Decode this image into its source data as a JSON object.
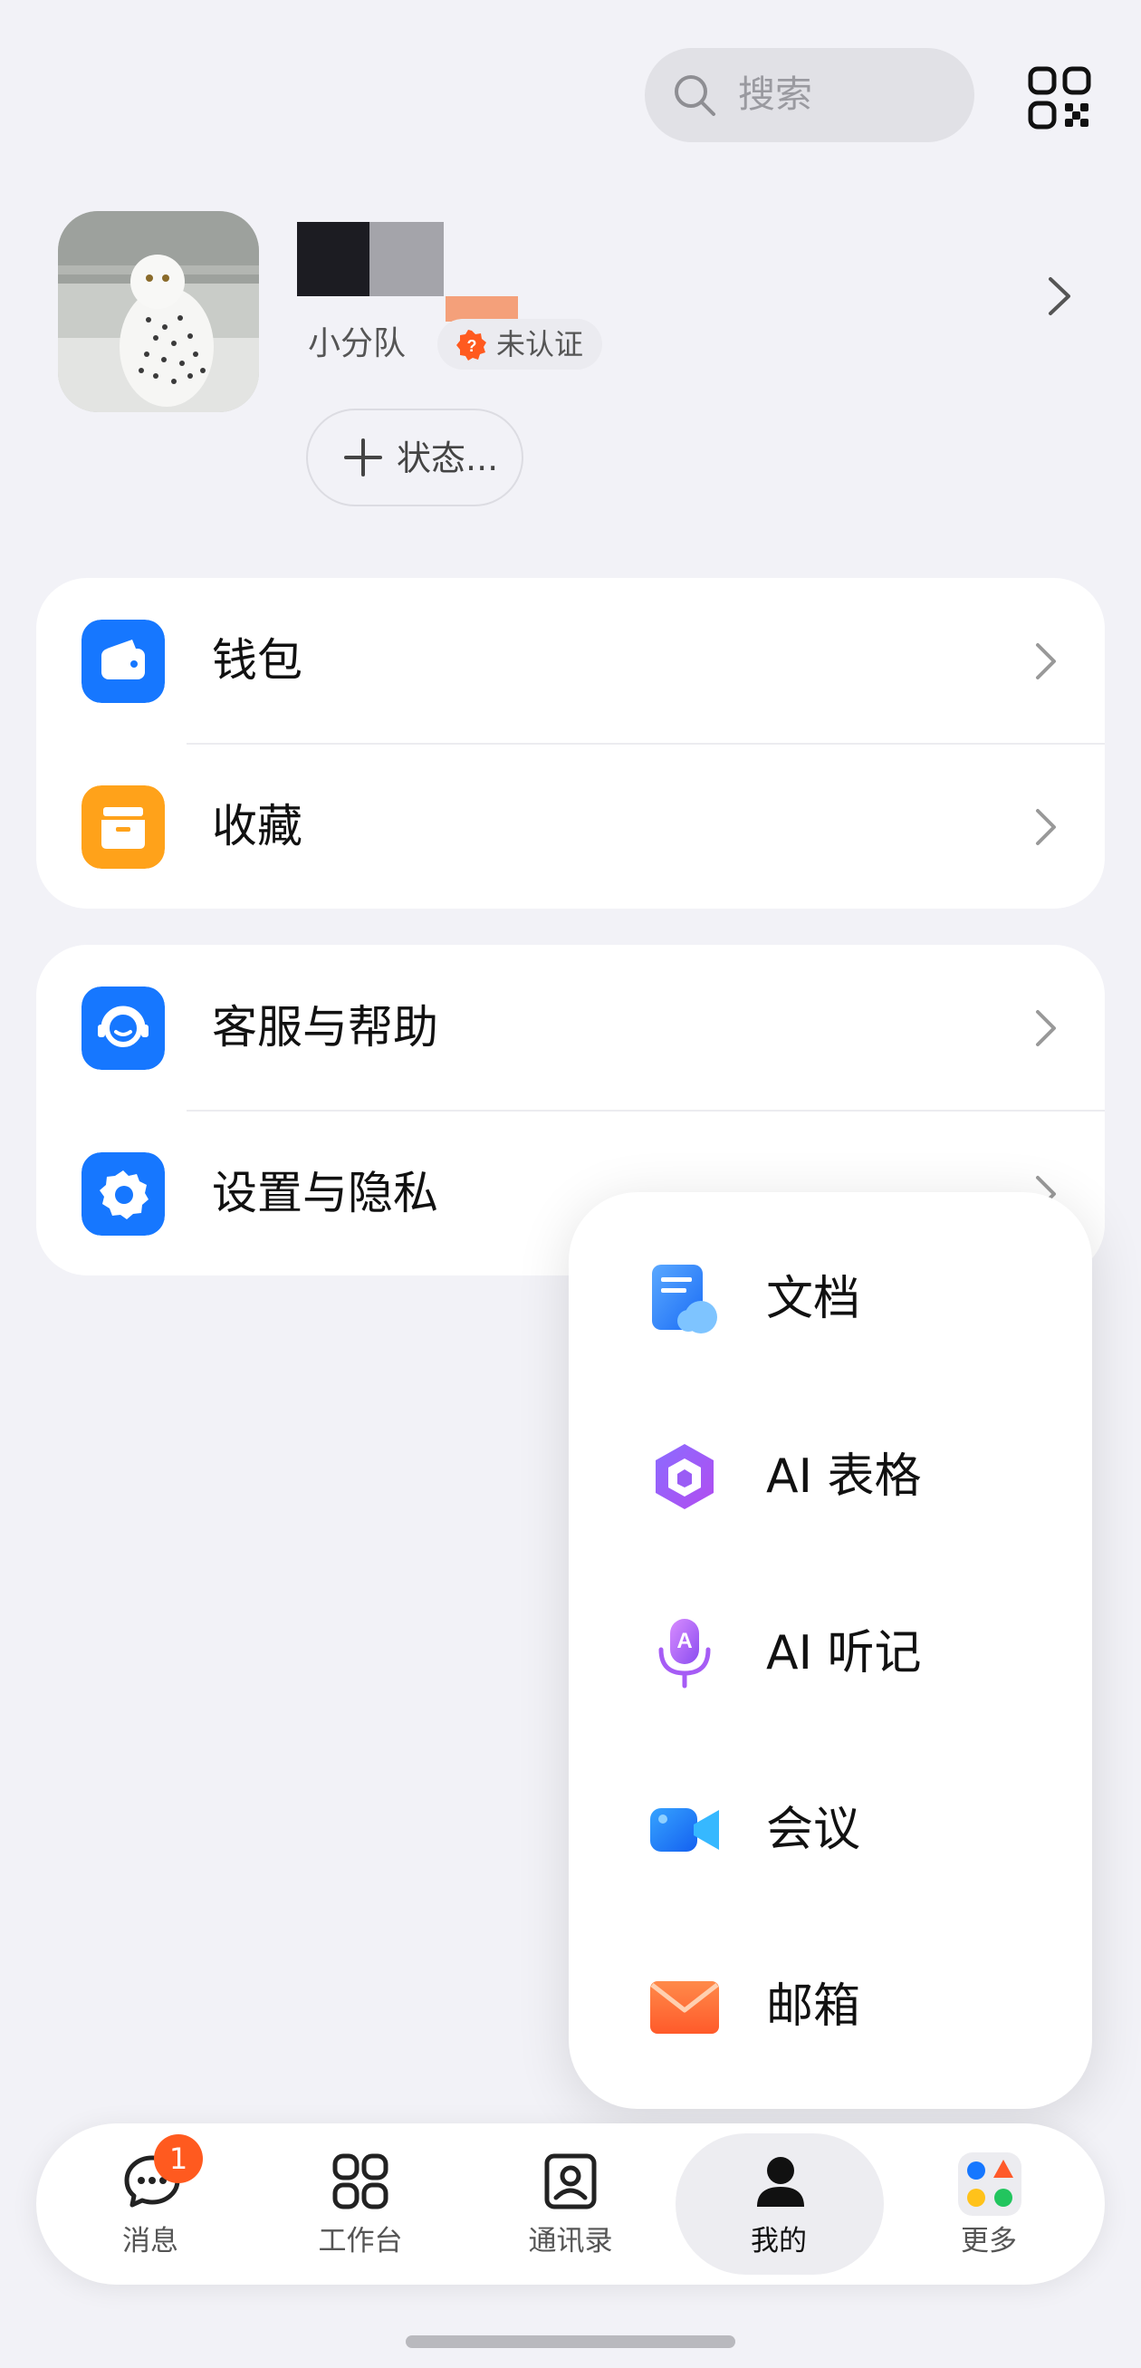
{
  "search": {
    "placeholder": "搜索"
  },
  "profile": {
    "team": "小分队",
    "badge": "未认证",
    "status_button": "状态..."
  },
  "menu_group1": [
    {
      "label": "钱包",
      "icon": "wallet-icon"
    },
    {
      "label": "收藏",
      "icon": "favorites-icon"
    }
  ],
  "menu_group2": [
    {
      "label": "客服与帮助",
      "icon": "customer-service-icon"
    },
    {
      "label": "设置与隐私",
      "icon": "settings-icon"
    }
  ],
  "popup_menu": [
    {
      "label": "文档",
      "icon": "document-icon"
    },
    {
      "label": "AI 表格",
      "icon": "ai-table-icon"
    },
    {
      "label": "AI 听记",
      "icon": "ai-listen-icon"
    },
    {
      "label": "会议",
      "icon": "meeting-icon"
    },
    {
      "label": "邮箱",
      "icon": "mail-icon"
    }
  ],
  "tabs": [
    {
      "label": "消息",
      "icon": "message-icon",
      "badge": "1"
    },
    {
      "label": "工作台",
      "icon": "workbench-icon"
    },
    {
      "label": "通讯录",
      "icon": "contacts-icon"
    },
    {
      "label": "我的",
      "icon": "me-icon",
      "active": true
    },
    {
      "label": "更多",
      "icon": "more-apps-icon"
    }
  ],
  "colors": {
    "background": "#f2f2f7",
    "accent_blue": "#1677ff",
    "favorites_orange": "#ffa21a",
    "badge_red": "#ff5a1f"
  }
}
